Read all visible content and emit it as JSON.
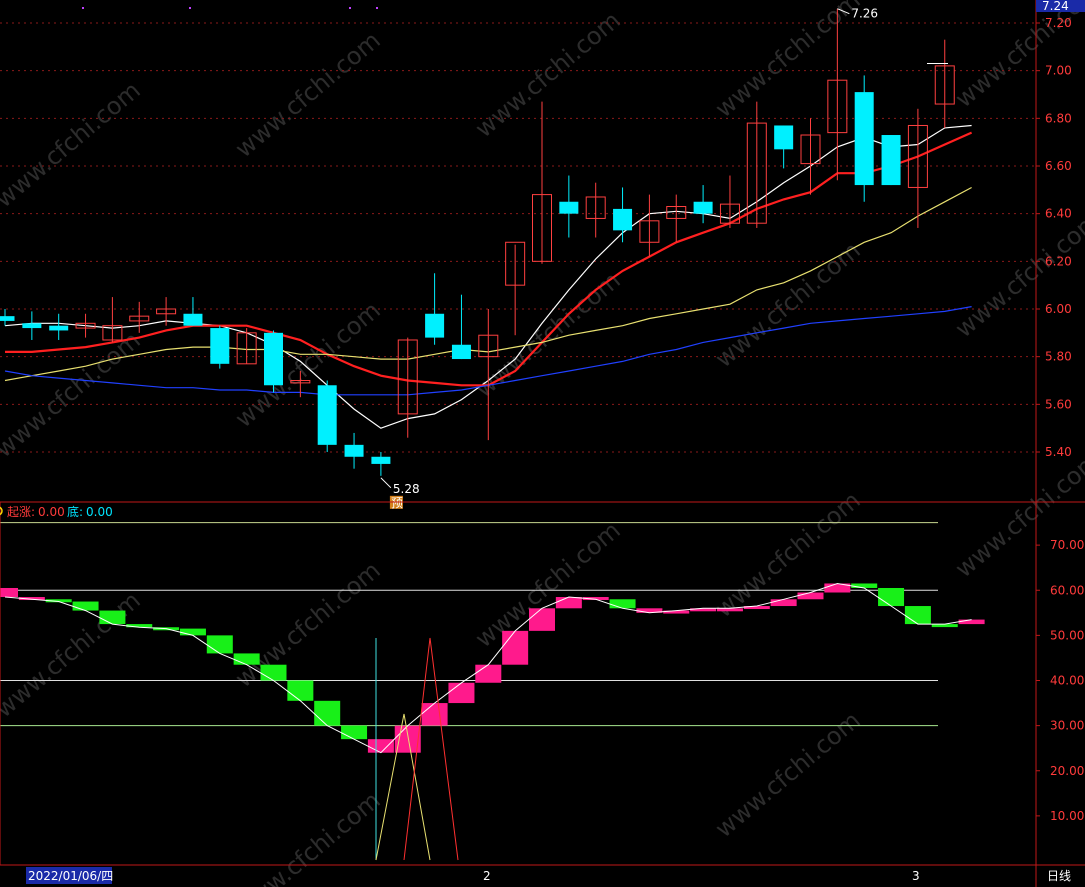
{
  "chart_data": [
    {
      "type": "candlestick",
      "pane": "price",
      "title": "",
      "ylim": [
        5.28,
        7.36
      ],
      "y_ticks": [
        "5.40",
        "5.60",
        "5.80",
        "6.00",
        "6.20",
        "6.40",
        "6.60",
        "6.80",
        "7.00",
        "7.20"
      ],
      "current_price_label": "7.24",
      "high_label": "7.26",
      "low_label": "5.28",
      "badge_text": "预",
      "candles": [
        {
          "o": 5.97,
          "h": 6.0,
          "l": 5.93,
          "c": 5.95
        },
        {
          "o": 5.94,
          "h": 5.99,
          "l": 5.87,
          "c": 5.92
        },
        {
          "o": 5.93,
          "h": 5.98,
          "l": 5.87,
          "c": 5.91
        },
        {
          "o": 5.92,
          "h": 5.98,
          "l": 5.88,
          "c": 5.94
        },
        {
          "o": 5.87,
          "h": 6.05,
          "l": 5.86,
          "c": 5.93
        },
        {
          "o": 5.95,
          "h": 6.03,
          "l": 5.9,
          "c": 5.97
        },
        {
          "o": 5.98,
          "h": 6.05,
          "l": 5.93,
          "c": 6.0
        },
        {
          "o": 5.98,
          "h": 6.05,
          "l": 5.93,
          "c": 5.93
        },
        {
          "o": 5.92,
          "h": 5.93,
          "l": 5.75,
          "c": 5.77
        },
        {
          "o": 5.77,
          "h": 5.92,
          "l": 5.77,
          "c": 5.9
        },
        {
          "o": 5.9,
          "h": 5.91,
          "l": 5.65,
          "c": 5.68
        },
        {
          "o": 5.69,
          "h": 5.74,
          "l": 5.63,
          "c": 5.7
        },
        {
          "o": 5.68,
          "h": 5.7,
          "l": 5.4,
          "c": 5.43
        },
        {
          "o": 5.43,
          "h": 5.48,
          "l": 5.33,
          "c": 5.38
        },
        {
          "o": 5.38,
          "h": 5.4,
          "l": 5.3,
          "c": 5.35
        },
        {
          "o": 5.56,
          "h": 5.88,
          "l": 5.46,
          "c": 5.87
        },
        {
          "o": 5.98,
          "h": 6.15,
          "l": 5.85,
          "c": 5.88
        },
        {
          "o": 5.85,
          "h": 6.06,
          "l": 5.79,
          "c": 5.79
        },
        {
          "o": 5.8,
          "h": 6.0,
          "l": 5.45,
          "c": 5.89
        },
        {
          "o": 6.1,
          "h": 6.27,
          "l": 5.89,
          "c": 6.28
        },
        {
          "o": 6.2,
          "h": 6.87,
          "l": 6.19,
          "c": 6.48
        },
        {
          "o": 6.45,
          "h": 6.56,
          "l": 6.3,
          "c": 6.4
        },
        {
          "o": 6.38,
          "h": 6.53,
          "l": 6.3,
          "c": 6.47
        },
        {
          "o": 6.42,
          "h": 6.51,
          "l": 6.28,
          "c": 6.33
        },
        {
          "o": 6.28,
          "h": 6.48,
          "l": 6.22,
          "c": 6.37
        },
        {
          "o": 6.38,
          "h": 6.48,
          "l": 6.28,
          "c": 6.43
        },
        {
          "o": 6.45,
          "h": 6.52,
          "l": 6.36,
          "c": 6.4
        },
        {
          "o": 6.36,
          "h": 6.56,
          "l": 6.34,
          "c": 6.44
        },
        {
          "o": 6.36,
          "h": 6.87,
          "l": 6.34,
          "c": 6.78
        },
        {
          "o": 6.77,
          "h": 6.77,
          "l": 6.59,
          "c": 6.67
        },
        {
          "o": 6.61,
          "h": 6.8,
          "l": 6.48,
          "c": 6.73
        },
        {
          "o": 6.74,
          "h": 7.26,
          "l": 6.54,
          "c": 6.96
        },
        {
          "o": 6.91,
          "h": 6.98,
          "l": 6.45,
          "c": 6.52
        },
        {
          "o": 6.73,
          "h": 6.73,
          "l": 6.52,
          "c": 6.52
        },
        {
          "o": 6.51,
          "h": 6.84,
          "l": 6.34,
          "c": 6.77
        },
        {
          "o": 6.86,
          "h": 7.13,
          "l": 6.76,
          "c": 7.02
        }
      ],
      "series": [
        {
          "color": "#ffffff",
          "values": [
            5.93,
            5.94,
            5.94,
            5.93,
            5.92,
            5.93,
            5.95,
            5.94,
            5.93,
            5.9,
            5.85,
            5.78,
            5.68,
            5.58,
            5.5,
            5.54,
            5.56,
            5.62,
            5.7,
            5.79,
            5.94,
            6.08,
            6.21,
            6.32,
            6.4,
            6.41,
            6.4,
            6.38,
            6.45,
            6.53,
            6.6,
            6.68,
            6.72,
            6.68,
            6.69,
            6.76,
            6.77
          ]
        },
        {
          "color": "#ff2020",
          "values": [
            5.82,
            5.82,
            5.83,
            5.84,
            5.86,
            5.88,
            5.91,
            5.93,
            5.93,
            5.93,
            5.9,
            5.87,
            5.81,
            5.76,
            5.72,
            5.7,
            5.69,
            5.68,
            5.68,
            5.74,
            5.86,
            5.98,
            6.08,
            6.16,
            6.22,
            6.28,
            6.32,
            6.36,
            6.42,
            6.46,
            6.49,
            6.57,
            6.57,
            6.6,
            6.64,
            6.69,
            6.74
          ]
        },
        {
          "color": "#e8e070",
          "values": [
            5.7,
            5.72,
            5.74,
            5.76,
            5.79,
            5.81,
            5.83,
            5.84,
            5.84,
            5.83,
            5.83,
            5.81,
            5.81,
            5.8,
            5.79,
            5.79,
            5.81,
            5.83,
            5.82,
            5.84,
            5.86,
            5.89,
            5.91,
            5.93,
            5.96,
            5.98,
            6.0,
            6.02,
            6.08,
            6.11,
            6.16,
            6.22,
            6.28,
            6.32,
            6.39,
            6.45,
            6.51
          ]
        },
        {
          "color": "#2040ff",
          "values": [
            5.74,
            5.72,
            5.71,
            5.7,
            5.69,
            5.68,
            5.67,
            5.67,
            5.66,
            5.66,
            5.65,
            5.65,
            5.64,
            5.64,
            5.64,
            5.64,
            5.65,
            5.66,
            5.68,
            5.7,
            5.72,
            5.74,
            5.76,
            5.78,
            5.81,
            5.83,
            5.86,
            5.88,
            5.9,
            5.92,
            5.94,
            5.95,
            5.96,
            5.97,
            5.98,
            5.99,
            6.01
          ]
        }
      ]
    },
    {
      "type": "bar",
      "pane": "indicator",
      "ylim": [
        0,
        80
      ],
      "y_ticks": [
        "10.00",
        "20.00",
        "30.00",
        "40.00",
        "50.00",
        "60.00",
        "70.00"
      ],
      "legend": [
        {
          "label": "起涨:",
          "value": "0.00",
          "color": "#ff3b3b"
        },
        {
          "label": "底:",
          "value": "0.00",
          "color": "#00e5ff"
        }
      ],
      "values": [
        58.0,
        57.5,
        55.5,
        52.5,
        51.8,
        51.5,
        50.0,
        46.0,
        43.5,
        40.0,
        35.5,
        30.0,
        27.0,
        24.0,
        30.0,
        35.0,
        39.5,
        43.5,
        51.0,
        56.0,
        58.5,
        58.0,
        56.0,
        55.0,
        55.5,
        56.0,
        56.0,
        56.5,
        58.0,
        59.5,
        61.5,
        60.5,
        56.5,
        52.5,
        52.5,
        53.5
      ],
      "up": [
        true,
        true,
        false,
        false,
        false,
        false,
        false,
        false,
        false,
        false,
        false,
        false,
        false,
        false,
        true,
        true,
        true,
        true,
        true,
        true,
        true,
        true,
        true,
        false,
        true,
        true,
        true,
        true,
        true,
        true,
        true,
        true,
        false,
        false,
        false,
        false,
        true
      ],
      "values_first_bar": 58.5,
      "level_lines": [
        75,
        60,
        40,
        30
      ],
      "colors": {
        "up": "#ff1a8c",
        "down": "#18f018"
      },
      "date_labels": [
        "2022/01/06/四",
        "2",
        "3"
      ],
      "period_label": "日线"
    }
  ]
}
